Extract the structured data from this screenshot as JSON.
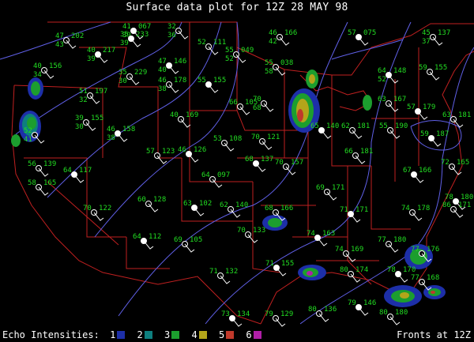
{
  "title": "Surface data plot for 12Z 28 MAY 98",
  "legend": {
    "label": "Echo Intensities:",
    "levels": [
      {
        "n": "1",
        "color": "#1d2fa8"
      },
      {
        "n": "2",
        "color": "#0e7f7f"
      },
      {
        "n": "3",
        "color": "#1c9e2e"
      },
      {
        "n": "4",
        "color": "#b3a51a"
      },
      {
        "n": "5",
        "color": "#c0392b"
      },
      {
        "n": "6",
        "color": "#b01ea8"
      }
    ]
  },
  "fronts_label": "Fronts at 12Z",
  "colors": {
    "background": "#000000",
    "borders": "#c02020",
    "isobars": "#6060e8",
    "station_text": "#22dd22",
    "title": "#ffffff"
  },
  "stations": [
    {
      "t": "41",
      "td": "39",
      "p": "067"
    },
    {
      "t": "32",
      "td": "36"
    },
    {
      "t": "47",
      "td": "43",
      "p": "202"
    },
    {
      "t": "35",
      "td": "39",
      "p": "233"
    },
    {
      "t": "52",
      "td": "111"
    },
    {
      "t": "46",
      "td": "42",
      "p": "166"
    },
    {
      "t": "57",
      "p": "075"
    },
    {
      "t": "45",
      "td": "37",
      "p": "137"
    },
    {
      "t": "40",
      "td": "34",
      "p": "156"
    },
    {
      "t": "40",
      "td": "39",
      "p": "217"
    },
    {
      "t": "55",
      "td": "52",
      "p": "049"
    },
    {
      "t": "55",
      "td": "58",
      "p": "038"
    },
    {
      "t": "47",
      "td": "40",
      "p": "146"
    },
    {
      "t": "35",
      "td": "30",
      "p": "229"
    },
    {
      "t": "46",
      "td": "38",
      "p": "178"
    },
    {
      "t": "64",
      "td": "52",
      "p": "148"
    },
    {
      "t": "59",
      "td": "155"
    },
    {
      "t": "51",
      "td": "32",
      "p": "197"
    },
    {
      "t": "55",
      "td": "155"
    },
    {
      "t": "70",
      "td": "68"
    },
    {
      "t": "63",
      "td": "167"
    },
    {
      "t": "57",
      "td": "179"
    },
    {
      "t": "63",
      "td": "181"
    },
    {
      "t": "39",
      "td": "30",
      "p": "155"
    },
    {
      "t": "46",
      "td": "38",
      "p": "158"
    },
    {
      "t": "40",
      "td": "169"
    },
    {
      "t": "66",
      "p": "105"
    },
    {
      "t": "65",
      "td": "140"
    },
    {
      "t": "62",
      "td": "181"
    },
    {
      "t": "55",
      "td": "190"
    },
    {
      "t": "59",
      "td": "187"
    },
    {
      "t": "52",
      "td": "41"
    },
    {
      "t": "57",
      "p": "123"
    },
    {
      "t": "46",
      "td": "126"
    },
    {
      "t": "53",
      "td": "108"
    },
    {
      "t": "70",
      "td": "121"
    },
    {
      "t": "68",
      "td": "137"
    },
    {
      "t": "70",
      "td": "157"
    },
    {
      "t": "66",
      "td": "181"
    },
    {
      "t": "67",
      "td": "166"
    },
    {
      "t": "72",
      "td": "165"
    },
    {
      "t": "56",
      "td": "139"
    },
    {
      "t": "64",
      "td": "117"
    },
    {
      "t": "64",
      "td": "097"
    },
    {
      "t": "69",
      "td": "171"
    },
    {
      "t": "78",
      "td": "180"
    },
    {
      "t": "58",
      "td": "165"
    },
    {
      "t": "60",
      "td": "128"
    },
    {
      "t": "63",
      "td": "102"
    },
    {
      "t": "62",
      "td": "140"
    },
    {
      "t": "68",
      "td": "166"
    },
    {
      "t": "71",
      "td": "171"
    },
    {
      "t": "74",
      "td": "178"
    },
    {
      "t": "70",
      "td": "122"
    },
    {
      "t": "64",
      "p": "112"
    },
    {
      "t": "69",
      "td": "105"
    },
    {
      "t": "70",
      "td": "133"
    },
    {
      "t": "74",
      "td": "163"
    },
    {
      "t": "77",
      "td": "180"
    },
    {
      "t": "77",
      "td": "176"
    },
    {
      "t": "71",
      "td": "155"
    },
    {
      "t": "74",
      "td": "169"
    },
    {
      "t": "80",
      "td": "174"
    },
    {
      "t": "78",
      "td": "170"
    },
    {
      "t": "71",
      "td": "132"
    },
    {
      "t": "77",
      "td": "168"
    },
    {
      "t": "73",
      "td": "134"
    },
    {
      "t": "79",
      "td": "129"
    },
    {
      "t": "80",
      "td": "136"
    },
    {
      "t": "79",
      "td": "146"
    },
    {
      "t": "80",
      "td": "180"
    },
    {
      "t": "86",
      "td": "171"
    }
  ]
}
